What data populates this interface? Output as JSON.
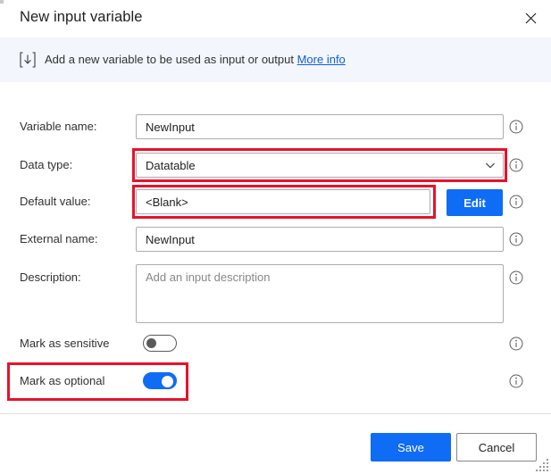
{
  "window": {
    "title": "New input variable",
    "close_icon": "close-icon"
  },
  "banner": {
    "icon": "import-variable-icon",
    "text": "Add a new variable to be used as input or output",
    "link_label": "More info",
    "background": "#f3f7fd",
    "link_color": "#0f5ed7"
  },
  "form": {
    "info_icon": "info-icon",
    "fields": [
      {
        "label": "Variable name:",
        "type": "text",
        "value": "NewInput",
        "placeholder": "",
        "highlighted": false
      },
      {
        "label": "Data type:",
        "type": "select",
        "value": "Datatable",
        "chevron_icon": "chevron-down-icon",
        "highlighted": true
      },
      {
        "label": "Default value:",
        "type": "text-with-button",
        "value": "<Blank>",
        "button_label": "Edit",
        "highlighted": true
      },
      {
        "label": "External name:",
        "type": "text",
        "value": "NewInput",
        "placeholder": "",
        "highlighted": false
      },
      {
        "label": "Description:",
        "type": "textarea",
        "value": "",
        "placeholder": "Add an input description",
        "highlighted": false
      }
    ],
    "toggles": [
      {
        "label": "Mark as sensitive",
        "state": "off",
        "highlighted": false
      },
      {
        "label": "Mark as optional",
        "state": "on",
        "highlighted": true
      }
    ]
  },
  "footer": {
    "save_label": "Save",
    "cancel_label": "Cancel",
    "resize_grip": "resize-grip-icon"
  },
  "colors": {
    "accent": "#0f6cf5",
    "highlight": "#e8112d",
    "banner_bg": "#f3f7fd",
    "border": "#adadad"
  }
}
